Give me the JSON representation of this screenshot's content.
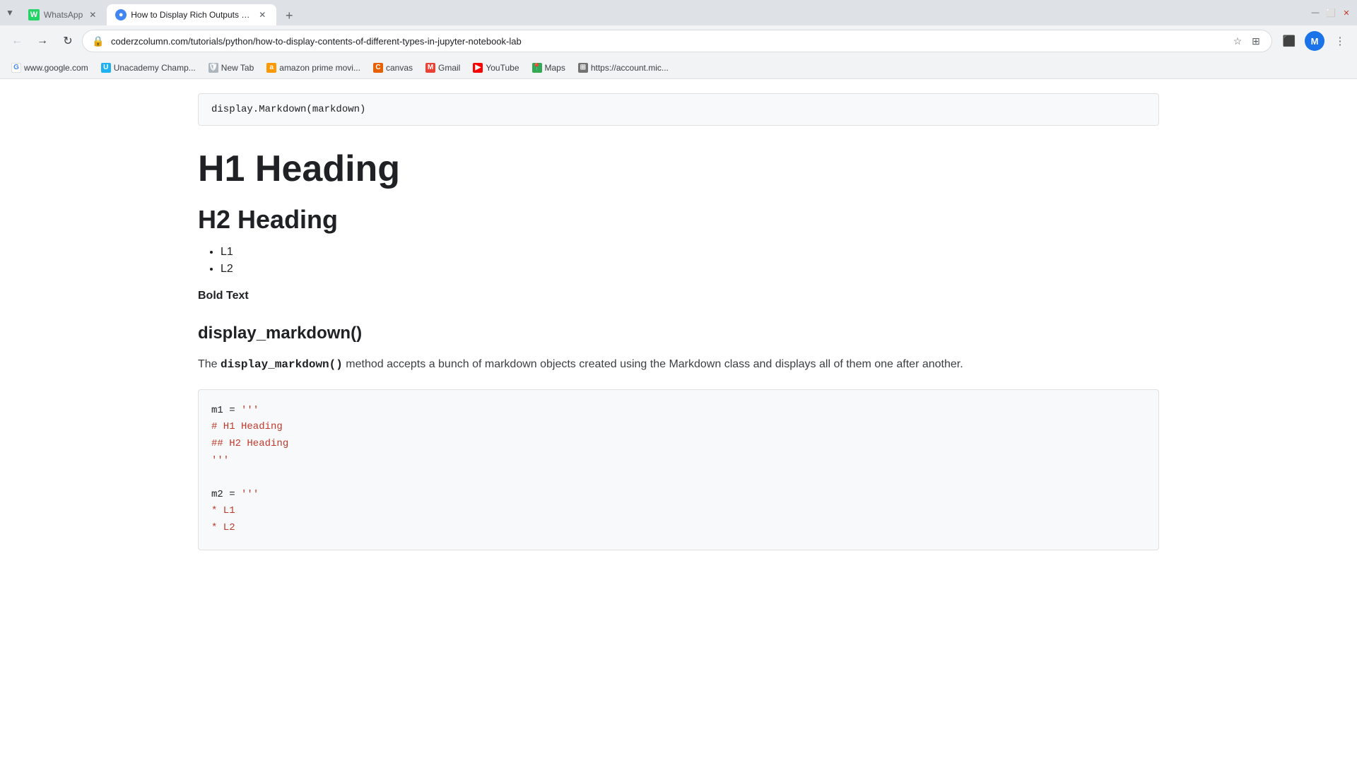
{
  "window": {
    "title": "How to Display Rich Outputs"
  },
  "tabs": [
    {
      "id": "whatsapp-tab",
      "label": "WhatsApp",
      "favicon_type": "whatsapp",
      "active": false
    },
    {
      "id": "richoutputs-tab",
      "label": "How to Display Rich Outputs (in...",
      "favicon_type": "chromium",
      "active": true
    }
  ],
  "address_bar": {
    "url": "coderzcolumn.com/tutorials/python/how-to-display-contents-of-different-types-in-jupyter-notebook-lab"
  },
  "bookmarks": [
    {
      "id": "google",
      "label": "www.google.com",
      "favicon_type": "google"
    },
    {
      "id": "unacademy",
      "label": "Unacademy Champ...",
      "favicon_type": "unacademy"
    },
    {
      "id": "newtab",
      "label": "New Tab",
      "favicon_type": "protected"
    },
    {
      "id": "amazon",
      "label": "amazon prime movi...",
      "favicon_type": "amazon"
    },
    {
      "id": "canvas",
      "label": "canvas",
      "favicon_type": "canvas"
    },
    {
      "id": "gmail",
      "label": "Gmail",
      "favicon_type": "gmail"
    },
    {
      "id": "youtube",
      "label": "YouTube",
      "favicon_type": "youtube"
    },
    {
      "id": "maps",
      "label": "Maps",
      "favicon_type": "maps"
    },
    {
      "id": "microsoftaccount",
      "label": "https://account.mic...",
      "favicon_type": "ms"
    }
  ],
  "page": {
    "code_top": "display.Markdown(markdown)",
    "h1": "H1 Heading",
    "h2": "H2 Heading",
    "list_items": [
      "L1",
      "L2"
    ],
    "bold_text": "Bold Text",
    "section_title": "display_markdown()",
    "paragraph_before_code": "The",
    "inline_code": "display_markdown()",
    "paragraph_after_code": "method accepts a bunch of markdown objects created using the Markdown class and displays all of them one after another.",
    "code_bottom_lines": [
      {
        "text": "m1 = '''",
        "color": "black"
      },
      {
        "text": "# H1 Heading",
        "color": "red"
      },
      {
        "text": "## H2 Heading",
        "color": "red"
      },
      {
        "text": "'''",
        "color": "black"
      },
      {
        "text": "",
        "color": "black"
      },
      {
        "text": "m2 = '''",
        "color": "black"
      },
      {
        "text": "* L1",
        "color": "red"
      },
      {
        "text": "* L2",
        "color": "red"
      }
    ]
  }
}
